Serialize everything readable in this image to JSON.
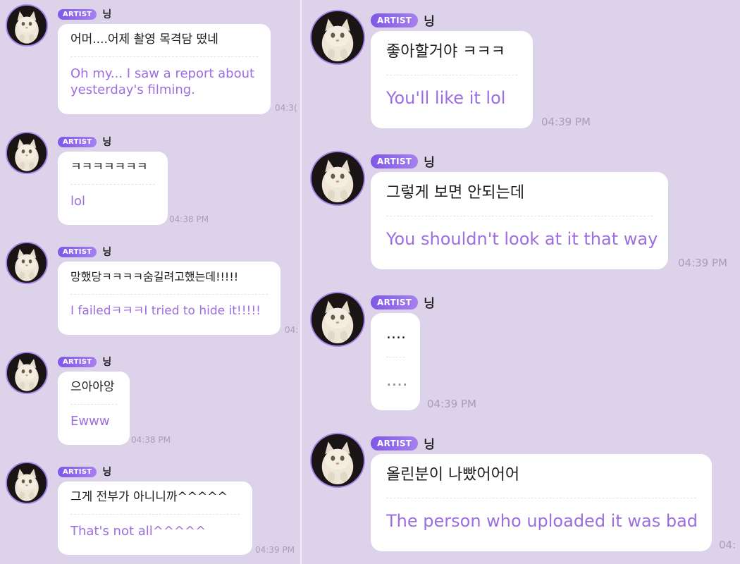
{
  "accent_color": "#a784e8",
  "badge_label": "ARTIST",
  "sender_name": "닝",
  "avatar_icon": "cat-photo-avatar",
  "left_messages": [
    {
      "korean": "어머....어제 촬영 목격담 떴네",
      "english": "Oh my... I saw a report about\nyesterday's filming.",
      "time": "04:3("
    },
    {
      "korean": "ㅋㅋㅋㅋㅋㅋㅋ",
      "english": "lol",
      "time": "04:38 PM"
    },
    {
      "korean": "망했당ㅋㅋㅋㅋ숨길려고했는데!!!!!",
      "english": "I failedㅋㅋㅋI tried to hide it!!!!!",
      "time": "04:"
    },
    {
      "korean": "으아아앙",
      "english": "Ewww",
      "time": "04:38 PM"
    },
    {
      "korean": "그게 전부가 아니니까^^^^^",
      "english": "That's not all^^^^^",
      "time": "04:39 PM"
    }
  ],
  "right_messages": [
    {
      "korean": "좋아할거야 ㅋㅋㅋ",
      "english": "You'll like it lol",
      "time": "04:39 PM"
    },
    {
      "korean": "그렇게 보면 안되는데",
      "english": "You shouldn't look at it that way",
      "time": "04:39 PM"
    },
    {
      "korean": "....",
      "english": "....",
      "time": "04:39 PM"
    },
    {
      "korean": "올린분이 나빴어어어",
      "english": "The person who uploaded it was bad",
      "time": "04:"
    }
  ]
}
